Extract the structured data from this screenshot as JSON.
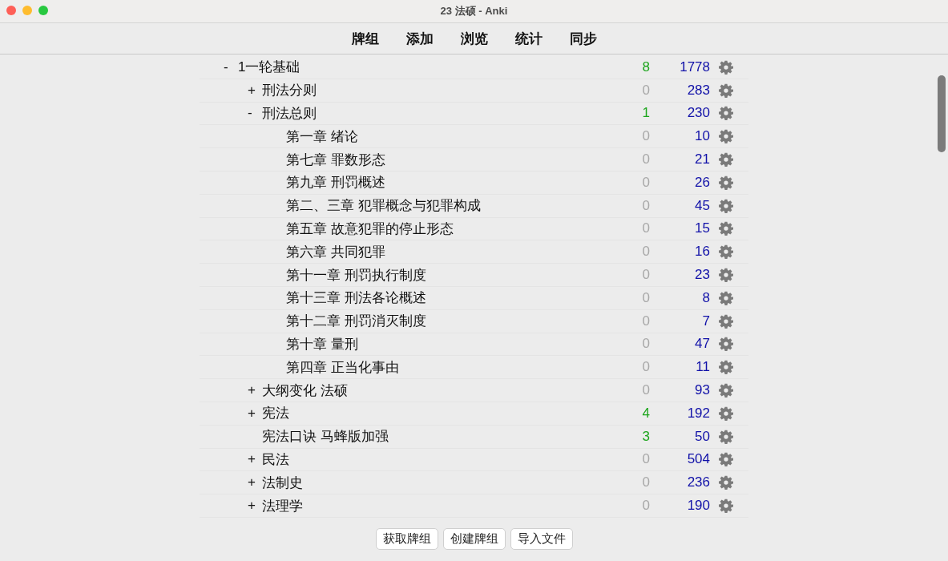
{
  "window": {
    "title": "23 法硕 - Anki"
  },
  "toolbar": [
    {
      "label": "牌组"
    },
    {
      "label": "添加"
    },
    {
      "label": "浏览"
    },
    {
      "label": "统计"
    },
    {
      "label": "同步"
    }
  ],
  "decks": [
    {
      "toggle": "-",
      "name": "1一轮基础",
      "new": {
        "text": "8",
        "dimmed": false
      },
      "due": "1778",
      "children": [
        {
          "toggle": "+",
          "name": "刑法分则",
          "new": {
            "text": "0",
            "dimmed": true
          },
          "due": "283"
        },
        {
          "toggle": "-",
          "name": "刑法总则",
          "new": {
            "text": "1",
            "dimmed": false
          },
          "due": "230",
          "children": [
            {
              "name": "第一章 绪论",
              "new": {
                "text": "0",
                "dimmed": true
              },
              "due": "10"
            },
            {
              "name": "第七章 罪数形态",
              "new": {
                "text": "0",
                "dimmed": true
              },
              "due": "21"
            },
            {
              "name": "第九章 刑罚概述",
              "new": {
                "text": "0",
                "dimmed": true
              },
              "due": "26"
            },
            {
              "name": "第二、三章 犯罪概念与犯罪构成",
              "new": {
                "text": "0",
                "dimmed": true
              },
              "due": "45"
            },
            {
              "name": "第五章 故意犯罪的停止形态",
              "new": {
                "text": "0",
                "dimmed": true
              },
              "due": "15"
            },
            {
              "name": "第六章 共同犯罪",
              "new": {
                "text": "0",
                "dimmed": true
              },
              "due": "16"
            },
            {
              "name": "第十一章 刑罚执行制度",
              "new": {
                "text": "0",
                "dimmed": true
              },
              "due": "23"
            },
            {
              "name": "第十三章 刑法各论概述",
              "new": {
                "text": "0",
                "dimmed": true
              },
              "due": "8"
            },
            {
              "name": "第十二章 刑罚消灭制度",
              "new": {
                "text": "0",
                "dimmed": true
              },
              "due": "7"
            },
            {
              "name": "第十章 量刑",
              "new": {
                "text": "0",
                "dimmed": true
              },
              "due": "47"
            },
            {
              "name": "第四章 正当化事由",
              "new": {
                "text": "0",
                "dimmed": true
              },
              "due": "11"
            }
          ]
        },
        {
          "toggle": "+",
          "name": "大纲变化 法硕",
          "new": {
            "text": "0",
            "dimmed": true
          },
          "due": "93"
        },
        {
          "toggle": "+",
          "name": "宪法",
          "new": {
            "text": "4",
            "dimmed": false
          },
          "due": "192"
        },
        {
          "name": "宪法口诀 马蜂版加强",
          "new": {
            "text": "3",
            "dimmed": false
          },
          "due": "50"
        },
        {
          "toggle": "+",
          "name": "民法",
          "new": {
            "text": "0",
            "dimmed": true
          },
          "due": "504"
        },
        {
          "toggle": "+",
          "name": "法制史",
          "new": {
            "text": "0",
            "dimmed": true
          },
          "due": "236"
        },
        {
          "toggle": "+",
          "name": "法理学",
          "new": {
            "text": "0",
            "dimmed": true
          },
          "due": "190"
        }
      ]
    }
  ],
  "buttons": [
    {
      "label": "获取牌组"
    },
    {
      "label": "创建牌组"
    },
    {
      "label": "导入文件"
    }
  ]
}
